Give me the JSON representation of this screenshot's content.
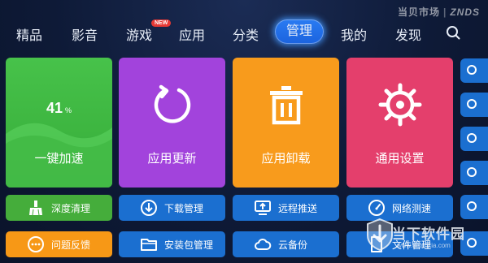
{
  "watermark_top": {
    "left": "当贝市场",
    "right": "ZNDS"
  },
  "nav": {
    "tabs": [
      "精品",
      "影音",
      "游戏",
      "应用",
      "分类",
      "管理",
      "我的",
      "发现"
    ],
    "active": "管理",
    "badge": "NEW"
  },
  "tiles": {
    "speed": {
      "percent": "41",
      "unit": "%",
      "label": "一键加速"
    },
    "update": {
      "label": "应用更新"
    },
    "uninstall": {
      "label": "应用卸载"
    },
    "settings": {
      "label": "通用设置"
    }
  },
  "buttons": {
    "deep_clean": "深度清理",
    "download_mgr": "下载管理",
    "remote_push": "远程推送",
    "net_test": "网络测速",
    "feedback": "问题反馈",
    "package_mgr": "安装包管理",
    "cloud_backup": "云备份",
    "file_mgr": "文件管理"
  },
  "watermark_bottom": {
    "title": "当下软件园",
    "url": "www.downxia.com"
  },
  "colors": {
    "green": "#47c24a",
    "purple": "#a243dc",
    "orange": "#f89b1c",
    "pink": "#e43f6c",
    "blue": "#1b6fd0"
  }
}
